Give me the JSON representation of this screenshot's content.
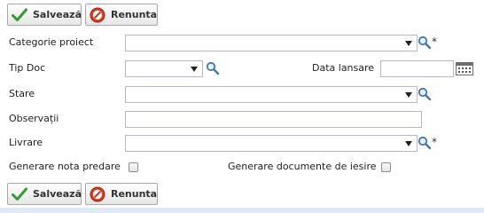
{
  "toolbar_top": {
    "save_label": "Salvează",
    "cancel_label": "Renunta"
  },
  "toolbar_bottom": {
    "save_label": "Salvează",
    "cancel_label": "Renunta"
  },
  "form": {
    "categorie": {
      "label": "Categorie proiect",
      "value": "",
      "required_mark": "*"
    },
    "tip_doc": {
      "label": "Tip Doc",
      "value": ""
    },
    "data_lansare": {
      "label": "Data lansare",
      "value": ""
    },
    "stare": {
      "label": "Stare",
      "value": ""
    },
    "observatii": {
      "label": "Observații",
      "value": ""
    },
    "livrare": {
      "label": "Livrare",
      "value": "",
      "required_mark": "*"
    },
    "generare_nota": {
      "label": "Generare nota predare",
      "checked": false
    },
    "generare_docs": {
      "label": "Generare documente de iesire",
      "checked": false
    }
  },
  "colors": {
    "save_check": "#2e9e2e",
    "cancel_red": "#d93a1f",
    "footer_bar": "#dfe8f6"
  }
}
